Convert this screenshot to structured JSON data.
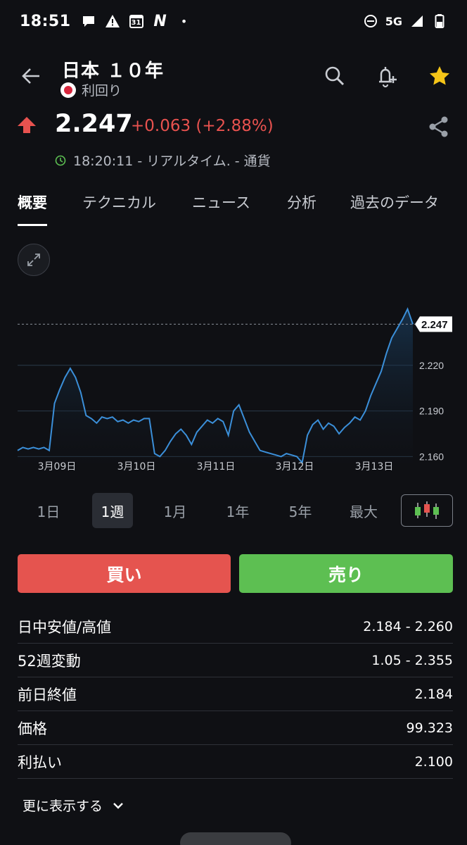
{
  "status_bar": {
    "time": "18:51",
    "calendar_day": "31",
    "network": "5G"
  },
  "header": {
    "title": "日本 １０年",
    "subtitle": "利回り"
  },
  "quote": {
    "price": "2.247",
    "change": "+0.063 (+2.88%)",
    "timestamp": "18:20:11 - リアルタイム. - 通貨"
  },
  "tabs": [
    "概要",
    "テクニカル",
    "ニュース",
    "分析",
    "過去のデータ"
  ],
  "chart_data": {
    "type": "area",
    "current_value_label": "2.247",
    "hidden_top_tick": "2.250",
    "y_ticks": [
      "2.220",
      "2.190",
      "2.160"
    ],
    "x_ticks": [
      "3月09日",
      "3月10日",
      "3月11日",
      "3月12日",
      "3月13日"
    ],
    "ylim": [
      2.15,
      2.262
    ],
    "series": [
      {
        "values": [
          2.164,
          2.166,
          2.165,
          2.166,
          2.165,
          2.166,
          2.164,
          2.195,
          2.204,
          2.212,
          2.218,
          2.212,
          2.202,
          2.187,
          2.185,
          2.182,
          2.186,
          2.185,
          2.186,
          2.183,
          2.184,
          2.182,
          2.184,
          2.183,
          2.185,
          2.185,
          2.162,
          2.16,
          2.164,
          2.17,
          2.175,
          2.178,
          2.174,
          2.168,
          2.176,
          2.18,
          2.184,
          2.182,
          2.185,
          2.183,
          2.174,
          2.19,
          2.194,
          2.185,
          2.176,
          2.17,
          2.164,
          2.163,
          2.162,
          2.161,
          2.16,
          2.162,
          2.161,
          2.16,
          2.156,
          2.174,
          2.181,
          2.184,
          2.178,
          2.182,
          2.18,
          2.175,
          2.179,
          2.182,
          2.186,
          2.184,
          2.19,
          2.2,
          2.208,
          2.216,
          2.228,
          2.238,
          2.244,
          2.25,
          2.257,
          2.247
        ]
      }
    ]
  },
  "time_ranges": [
    "1日",
    "1週",
    "1月",
    "1年",
    "5年",
    "最大"
  ],
  "active_range_index": 1,
  "trade": {
    "buy": "買い",
    "sell": "売り"
  },
  "stats": [
    {
      "label": "日中安値/高値",
      "value": "2.184 - 2.260"
    },
    {
      "label": "52週変動",
      "value": "1.05 - 2.355"
    },
    {
      "label": "前日終値",
      "value": "2.184"
    },
    {
      "label": "価格",
      "value": "99.323"
    },
    {
      "label": "利払い",
      "value": "2.100"
    }
  ],
  "more_label": "更に表示する",
  "colors": {
    "background": "#0f1014",
    "up": "#e8524f",
    "buy": "#e5544f",
    "sell": "#5dbf52",
    "line": "#3b8fd9",
    "star": "#f5c518"
  }
}
